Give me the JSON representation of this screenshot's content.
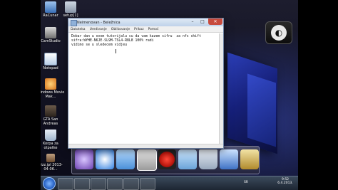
{
  "window": {
    "title": "Neimenovan - Beležnica",
    "menu": [
      "Datoteka",
      "Uredivanje",
      "Oblikovanje",
      "Prikaz",
      "Pomoć"
    ],
    "editor_lines": [
      "Dobar dan u ovom tutorijalu cu da vam kazem sifru  za nfs shift",
      "sifra:WYHE-N6JE-SL9M-TSL4-R8L8 100% radi",
      "vidimo se u sledecem vidjeu"
    ]
  },
  "desktop_icons": [
    {
      "label": "RaCunar"
    },
    {
      "label": "setup[1]"
    },
    {
      "label": "CamStudio"
    },
    {
      "label": "Notepad"
    },
    {
      "label": "Windows Movie Mak..."
    },
    {
      "label": "GTA San Andreas"
    },
    {
      "label": "Korpa za otpatke"
    },
    {
      "label": "pizz.jpl 2013-04-06..."
    }
  ],
  "taskbar": {
    "language": "SR",
    "time": "9:52",
    "date": "6.4.2013."
  },
  "colors": {
    "close_button": "#c74a3c",
    "wallpaper_accent": "#2c3fb8"
  }
}
